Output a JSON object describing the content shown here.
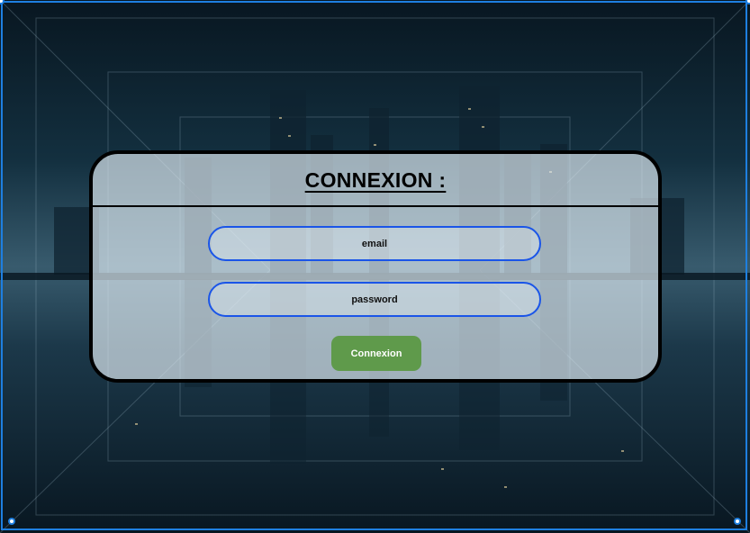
{
  "login": {
    "title": "CONNEXION :",
    "email_placeholder": "email",
    "password_placeholder": "password",
    "submit_label": "Connexion"
  },
  "colors": {
    "field_border": "#1a55e8",
    "button_bg": "#5f9a4b",
    "selection_frame": "#1e7fe0"
  }
}
